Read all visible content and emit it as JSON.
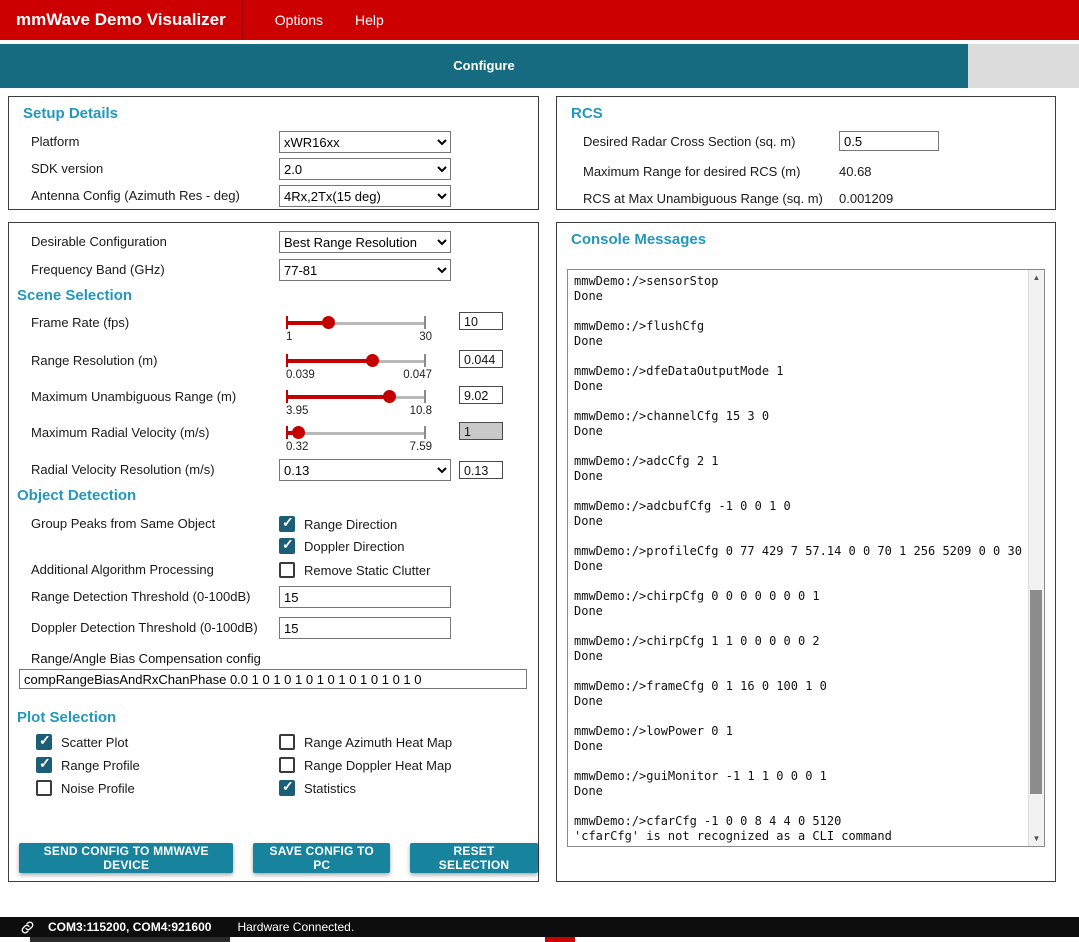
{
  "colors": {
    "brand_red": "#CC0000",
    "tab_teal": "#176B80",
    "heading_teal": "#2398BA",
    "button_teal": "#17839D",
    "checkbox_checked": "#1C5D77"
  },
  "header": {
    "title": "mmWave Demo Visualizer",
    "menus": [
      {
        "label": "Options"
      },
      {
        "label": "Help"
      }
    ]
  },
  "tabbar": {
    "active_tab": "Configure"
  },
  "setup_details": {
    "title": "Setup Details",
    "fields": [
      {
        "label": "Platform",
        "value": "xWR16xx"
      },
      {
        "label": "SDK version",
        "value": "2.0"
      },
      {
        "label": "Antenna Config (Azimuth Res - deg)",
        "value": "4Rx,2Tx(15 deg)"
      }
    ]
  },
  "rcs": {
    "title": "RCS",
    "rows": [
      {
        "label": "Desired Radar Cross Section (sq. m)",
        "value": "0.5"
      },
      {
        "label": "Maximum Range for desired RCS (m)",
        "value": "40.68"
      },
      {
        "label": "RCS at Max Unambiguous Range (sq. m)",
        "value": "0.001209"
      }
    ]
  },
  "config": {
    "desirable_configuration": {
      "label": "Desirable Configuration",
      "value": "Best Range Resolution"
    },
    "frequency_band": {
      "label": "Frequency Band (GHz)",
      "value": "77-81"
    },
    "scene_selection": {
      "title": "Scene Selection",
      "sliders": [
        {
          "label": "Frame Rate (fps)",
          "min": "1",
          "max": "30",
          "value": "10",
          "percent": 31
        },
        {
          "label": "Range Resolution (m)",
          "min": "0.039",
          "max": "0.047",
          "value": "0.044",
          "percent": 62
        },
        {
          "label": "Maximum Unambiguous Range (m)",
          "min": "3.95",
          "max": "10.8",
          "value": "9.02",
          "percent": 74
        },
        {
          "label": "Maximum Radial Velocity (m/s)",
          "min": "0.32",
          "max": "7.59",
          "value": "1",
          "percent": 9
        }
      ],
      "radial_velocity_resolution": {
        "label": "Radial Velocity Resolution (m/s)",
        "selected": "0.13",
        "value": "0.13"
      }
    },
    "object_detection": {
      "title": "Object Detection",
      "group_peaks": {
        "label": "Group Peaks from Same Object",
        "options": [
          {
            "label": "Range Direction",
            "state": "checked"
          },
          {
            "label": "Doppler Direction",
            "state": "checked"
          }
        ]
      },
      "additional_processing": {
        "label": "Additional Algorithm Processing",
        "options": [
          {
            "label": "Remove Static Clutter",
            "state": "unchecked"
          }
        ]
      },
      "range_threshold": {
        "label": "Range Detection Threshold (0-100dB)",
        "value": "15"
      },
      "doppler_threshold": {
        "label": "Doppler Detection Threshold (0-100dB)",
        "value": "15"
      },
      "bias_compensation": {
        "label": "Range/Angle Bias Compensation config",
        "value": "compRangeBiasAndRxChanPhase 0.0 1 0 1 0 1 0 1 0 1 0 1 0 1 0 1 0"
      }
    },
    "plot_selection": {
      "title": "Plot Selection",
      "options": [
        {
          "label": "Scatter Plot",
          "state": "checked"
        },
        {
          "label": "Range Azimuth Heat Map",
          "state": "unchecked"
        },
        {
          "label": "Range Profile",
          "state": "checked"
        },
        {
          "label": "Range Doppler Heat Map",
          "state": "unchecked"
        },
        {
          "label": "Noise Profile",
          "state": "unchecked"
        },
        {
          "label": "Statistics",
          "state": "checked"
        }
      ]
    },
    "buttons": [
      {
        "label": "SEND CONFIG TO MMWAVE DEVICE"
      },
      {
        "label": "SAVE CONFIG TO PC"
      },
      {
        "label": "RESET SELECTION"
      }
    ]
  },
  "console": {
    "title": "Console Messages",
    "text": "mmwDemo:/>sensorStop\nDone\n\nmmwDemo:/>flushCfg\nDone\n\nmmwDemo:/>dfeDataOutputMode 1\nDone\n\nmmwDemo:/>channelCfg 15 3 0\nDone\n\nmmwDemo:/>adcCfg 2 1\nDone\n\nmmwDemo:/>adcbufCfg -1 0 0 1 0\nDone\n\nmmwDemo:/>profileCfg 0 77 429 7 57.14 0 0 70 1 256 5209 0 0 30\nDone\n\nmmwDemo:/>chirpCfg 0 0 0 0 0 0 0 1\nDone\n\nmmwDemo:/>chirpCfg 1 1 0 0 0 0 0 2\nDone\n\nmmwDemo:/>frameCfg 0 1 16 0 100 1 0\nDone\n\nmmwDemo:/>lowPower 0 1\nDone\n\nmmwDemo:/>guiMonitor -1 1 1 0 0 0 1\nDone\n\nmmwDemo:/>cfarCfg -1 0 0 8 4 4 0 5120\n'cfarCfg' is not recognized as a CLI command"
  },
  "statusbar": {
    "ports": "COM3:115200, COM4:921600",
    "status": "Hardware Connected."
  }
}
